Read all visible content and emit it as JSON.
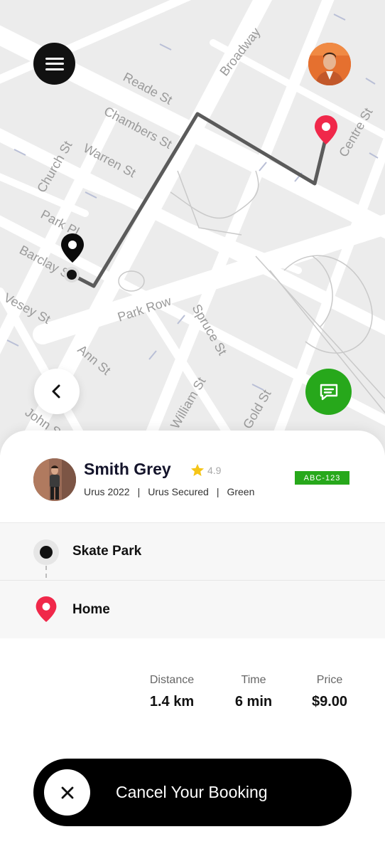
{
  "map": {
    "streets": [
      "Reade St",
      "Chambers St",
      "Broadway",
      "Church St",
      "Warren St",
      "Park Pl",
      "Barclay St",
      "Vesey St",
      "Park Row",
      "Spruce St",
      "Ann St",
      "John St",
      "William St",
      "Gold St",
      "Centre St"
    ],
    "route_color": "#5b5b5b",
    "destination_pin_color": "#f0284a"
  },
  "driver": {
    "name": "Smith Grey",
    "rating": "4.9",
    "car_model": "Urus 2022",
    "car_type": "Urus Secured",
    "car_color": "Green",
    "plate": "ABC-123",
    "separator": "|"
  },
  "route": {
    "from": "Skate Park",
    "to": "Home"
  },
  "stats": {
    "distance_label": "Distance",
    "distance_value": "1.4 km",
    "time_label": "Time",
    "time_value": "6 min",
    "price_label": "Price",
    "price_value": "$9.00"
  },
  "actions": {
    "cancel_label": "Cancel Your Booking"
  },
  "colors": {
    "accent_green": "#27a81b",
    "pin_red": "#f0284a",
    "star": "#f5c518",
    "dark": "#000000"
  },
  "icons": {
    "menu": "menu-icon",
    "back": "chevron-left-icon",
    "chat": "chat-icon",
    "star": "star-icon",
    "close": "close-icon"
  }
}
